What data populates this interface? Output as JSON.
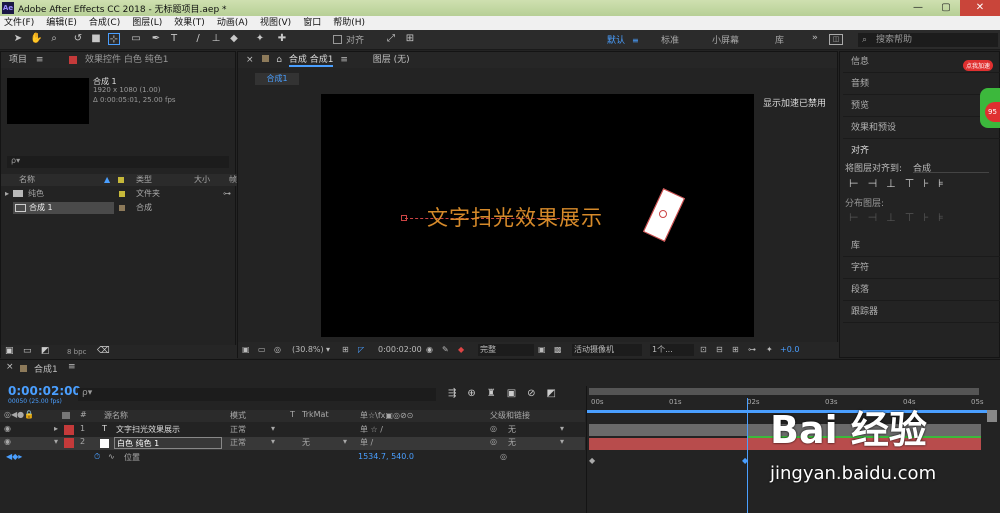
{
  "app": {
    "title": "Adobe After Effects CC 2018 - 无标题项目.aep *",
    "logo": "Ae"
  },
  "menu": [
    "文件(F)",
    "编辑(E)",
    "合成(C)",
    "图层(L)",
    "效果(T)",
    "动画(A)",
    "视图(V)",
    "窗口",
    "帮助(H)"
  ],
  "toolbar": {
    "align_label": "对齐",
    "workspaces": [
      "默认",
      "标准",
      "小屏幕",
      "库"
    ],
    "search_placeholder": "搜索帮助"
  },
  "project": {
    "tab": "项目",
    "effect_tab": "效果控件 白色 纯色1",
    "comp_name": "合成 1",
    "comp_info1": "1920 x 1080 (1.00)",
    "comp_info2": "Δ 0:00:05:01, 25.00 fps",
    "search_placeholder": "ρ▾",
    "cols": [
      "名称",
      "类型",
      "大小",
      "帧"
    ],
    "rows": [
      {
        "name": "纯色",
        "type": "文件夹"
      },
      {
        "name": "合成 1",
        "type": "合成"
      }
    ],
    "bpc": "8 bpc"
  },
  "composition": {
    "tab": "合成 合成1",
    "layer_tab": "图层 (无)",
    "sub_tab": "合成1",
    "accel_notice": "显示加速已禁用",
    "canvas_text": "文字扫光效果展示",
    "zoom": "(30.8%)",
    "time": "0:00:02:00",
    "quality": "完整",
    "camera": "活动摄像机",
    "views": "1个...",
    "offset": "+0.0"
  },
  "right_panel": {
    "items": [
      "信息",
      "音频",
      "预览",
      "效果和预设"
    ],
    "align": {
      "title": "对齐",
      "align_to_label": "将图层对齐到:",
      "align_to_value": "合成",
      "distribute_label": "分布图层:"
    },
    "items2": [
      "库",
      "字符",
      "段落",
      "跟踪器"
    ]
  },
  "timeline": {
    "tab": "合成1",
    "timecode": "0:00:02:00",
    "frames": "00050 (25.00 fps)",
    "cols": {
      "src": "源名称",
      "mode": "模式",
      "t": "T",
      "trkmat": "TrkMat",
      "switches": "单☆\\fx▣◎⊘⊙",
      "parent": "父级和链接"
    },
    "layers": [
      {
        "num": "1",
        "type": "T",
        "name": "文字扫光效果展示",
        "mode": "正常",
        "trkmat": "",
        "parent": "无",
        "color": "#c43a3a"
      },
      {
        "num": "2",
        "type": "",
        "name": "白色 纯色 1",
        "mode": "正常",
        "trkmat": "无",
        "parent": "无",
        "color": "#c43a3a"
      }
    ],
    "prop": {
      "name": "位置",
      "value": "1534.7, 540.0"
    },
    "ruler": [
      "00s",
      "01s",
      "02s",
      "03s",
      "04s",
      "05s"
    ],
    "playhead_seconds": 2,
    "duration_seconds": 5
  },
  "watermark": {
    "brand": "Bai 经验",
    "url": "jingyan.baidu.com"
  },
  "colors": {
    "accent": "#4a9fff",
    "layer_red": "#b84c4c",
    "ae_bg": "#232323"
  }
}
